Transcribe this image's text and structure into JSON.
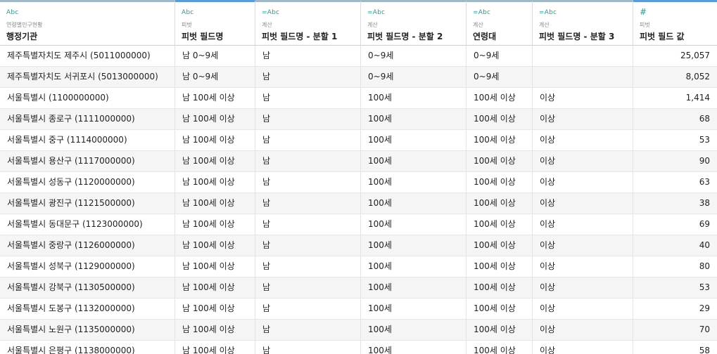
{
  "columns": [
    {
      "type_label": "Abc",
      "source": "연령별인구현황",
      "name": "행정기관"
    },
    {
      "type_label": "Abc",
      "source": "피벗",
      "name": "피벗 필드명"
    },
    {
      "type_label": "=Abc",
      "source": "계산",
      "name": "피벗 필드명 - 분할 1"
    },
    {
      "type_label": "=Abc",
      "source": "계산",
      "name": "피벗 필드명 - 분할 2"
    },
    {
      "type_label": "=Abc",
      "source": "계산",
      "name": "연령대"
    },
    {
      "type_label": "=Abc",
      "source": "계산",
      "name": "피벗 필드명 - 분할 3"
    },
    {
      "type_label": "#",
      "source": "피벗",
      "name": "피벗 필드 값"
    }
  ],
  "rows": [
    [
      "제주특별자치도 제주시 (5011000000)",
      "남 0~9세",
      "남",
      "0~9세",
      "0~9세",
      "",
      "25,057"
    ],
    [
      "제주특별자치도 서귀포시 (5013000000)",
      "남 0~9세",
      "남",
      "0~9세",
      "0~9세",
      "",
      "8,052"
    ],
    [
      "서울특별시  (1100000000)",
      "남 100세 이상",
      "남",
      "100세",
      "100세 이상",
      "이상",
      "1,414"
    ],
    [
      "서울특별시 종로구 (1111000000)",
      "남 100세 이상",
      "남",
      "100세",
      "100세 이상",
      "이상",
      "68"
    ],
    [
      "서울특별시 중구 (1114000000)",
      "남 100세 이상",
      "남",
      "100세",
      "100세 이상",
      "이상",
      "53"
    ],
    [
      "서울특별시 용산구 (1117000000)",
      "남 100세 이상",
      "남",
      "100세",
      "100세 이상",
      "이상",
      "90"
    ],
    [
      "서울특별시 성동구 (1120000000)",
      "남 100세 이상",
      "남",
      "100세",
      "100세 이상",
      "이상",
      "63"
    ],
    [
      "서울특별시 광진구 (1121500000)",
      "남 100세 이상",
      "남",
      "100세",
      "100세 이상",
      "이상",
      "38"
    ],
    [
      "서울특별시 동대문구 (1123000000)",
      "남 100세 이상",
      "남",
      "100세",
      "100세 이상",
      "이상",
      "69"
    ],
    [
      "서울특별시 중랑구 (1126000000)",
      "남 100세 이상",
      "남",
      "100세",
      "100세 이상",
      "이상",
      "40"
    ],
    [
      "서울특별시 성북구 (1129000000)",
      "남 100세 이상",
      "남",
      "100세",
      "100세 이상",
      "이상",
      "80"
    ],
    [
      "서울특별시 강북구 (1130500000)",
      "남 100세 이상",
      "남",
      "100세",
      "100세 이상",
      "이상",
      "53"
    ],
    [
      "서울특별시 도봉구 (1132000000)",
      "남 100세 이상",
      "남",
      "100세",
      "100세 이상",
      "이상",
      "29"
    ],
    [
      "서울특별시 노원구 (1135000000)",
      "남 100세 이상",
      "남",
      "100세",
      "100세 이상",
      "이상",
      "70"
    ],
    [
      "서울특별시 은평구 (1138000000)",
      "남 100세 이상",
      "남",
      "100세",
      "100세 이상",
      "이상",
      "58"
    ]
  ]
}
